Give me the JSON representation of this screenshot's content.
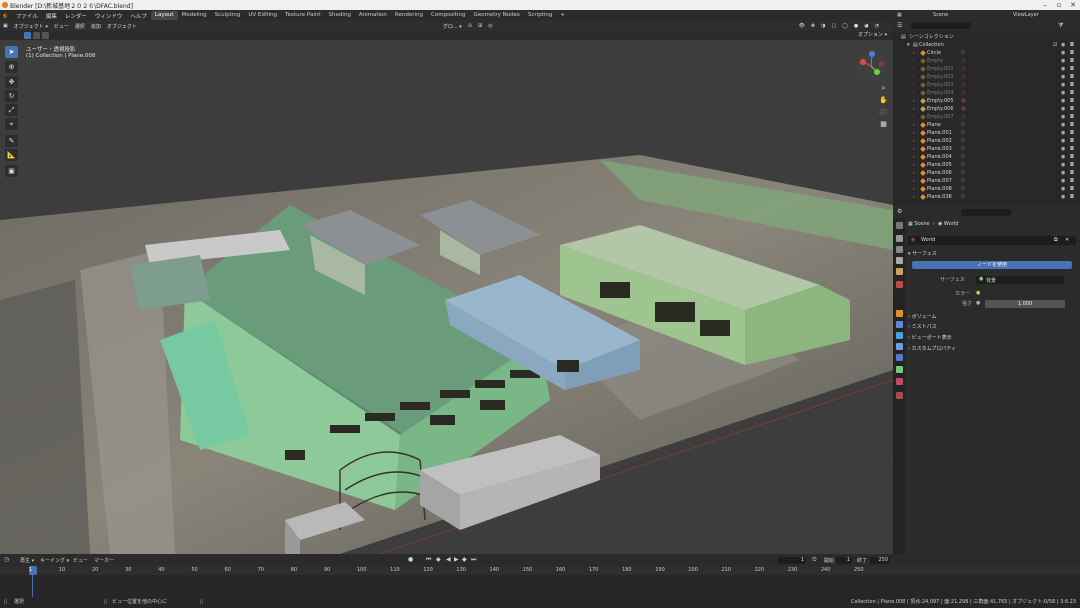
{
  "window": {
    "title": "Blender [D:\\新城基地２０２６\\DFAC.blend]"
  },
  "menus": [
    "ファイル",
    "編集",
    "レンダー",
    "ウィンドウ",
    "ヘルプ"
  ],
  "workspaces": [
    "Layout",
    "Modeling",
    "Sculpting",
    "UV Editing",
    "Texture Paint",
    "Shading",
    "Animation",
    "Rendering",
    "Compositing",
    "Geometry Nodes",
    "Scripting",
    "+"
  ],
  "active_workspace": "Layout",
  "scene_selector": {
    "label": "Scene",
    "viewlayer": "ViewLayer"
  },
  "viewport_header": {
    "mode": "オブジェクト ▾",
    "view": "ビュー",
    "select": "選択",
    "add": "追加",
    "object": "オブジェクト",
    "orientation": "グロ... ▾",
    "options": "オプション ▾"
  },
  "viewport_overlay": {
    "view_name": "ユーザー・透視投影",
    "collection_info": "(1) Collection | Plane.008"
  },
  "outliner": {
    "root": "シーンコレクション",
    "collection": "Collection",
    "items": [
      {
        "name": "Circle",
        "dim": false
      },
      {
        "name": "Empty",
        "dim": true
      },
      {
        "name": "Empty.001",
        "dim": true
      },
      {
        "name": "Empty.002",
        "dim": true
      },
      {
        "name": "Empty.003",
        "dim": true
      },
      {
        "name": "Empty.004",
        "dim": true
      },
      {
        "name": "Empty.005",
        "dim": false
      },
      {
        "name": "Empty.006",
        "dim": false
      },
      {
        "name": "Empty.007",
        "dim": true
      },
      {
        "name": "Plane",
        "dim": false
      },
      {
        "name": "Plane.001",
        "dim": false
      },
      {
        "name": "Plane.002",
        "dim": false
      },
      {
        "name": "Plane.003",
        "dim": false
      },
      {
        "name": "Plane.004",
        "dim": false
      },
      {
        "name": "Plane.005",
        "dim": false
      },
      {
        "name": "Plane.006",
        "dim": false
      },
      {
        "name": "Plane.007",
        "dim": false
      },
      {
        "name": "Plane.008",
        "dim": false
      },
      {
        "name": "Plane.036",
        "dim": false
      }
    ]
  },
  "properties": {
    "breadcrumb_scene": "Scene",
    "breadcrumb_world": "World",
    "world_name": "World",
    "surface_section": "サーフェス",
    "use_nodes_button": "ノードを使用",
    "surface_label": "サーフェス",
    "surface_value": "背景",
    "color_label": "カラー",
    "strength_label": "強さ",
    "strength_value": "1.000",
    "sections": [
      "ボリューム",
      "ミストパス",
      "ビューポート表示",
      "カスタムプロパティ"
    ]
  },
  "timeline": {
    "menus": [
      "再生 ▾",
      "キーイング ▾",
      "ビュー",
      "マーカー"
    ],
    "current_frame": "1",
    "start_label": "開始",
    "start_value": "1",
    "end_label": "終了",
    "end_value": "250",
    "ticks": [
      "1",
      "10",
      "20",
      "30",
      "40",
      "50",
      "60",
      "70",
      "80",
      "90",
      "100",
      "110",
      "120",
      "130",
      "140",
      "150",
      "160",
      "170",
      "180",
      "190",
      "200",
      "210",
      "220",
      "230",
      "240",
      "250"
    ]
  },
  "statusbar": {
    "left": "選択",
    "middle": "ビュー位置を他の中心に",
    "right": "Collection | Plane.008 | 頂点:24,097 | 面:21,298 | 三角面:41,765 | オブジェクト:0/58 | 3.6.23"
  },
  "colors": {
    "accent": "#4772b3",
    "orange": "#e87d0d",
    "green_mesh": "#7fc977"
  }
}
